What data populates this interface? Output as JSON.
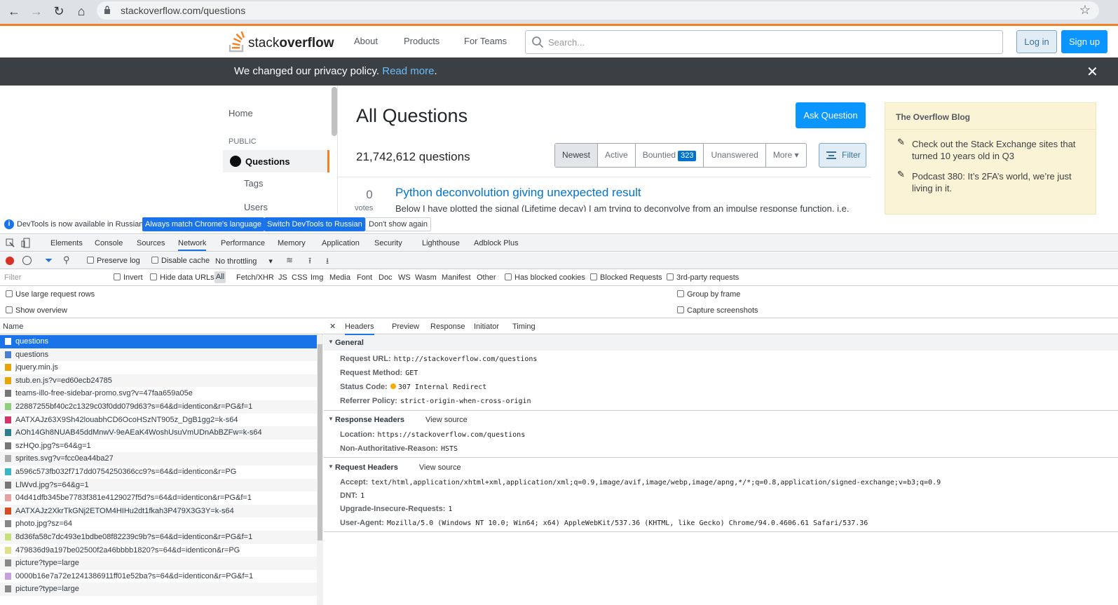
{
  "browser": {
    "url": "stackoverflow.com/questions"
  },
  "so": {
    "logo_prefix": "stack",
    "logo_bold": "overflow",
    "nav": [
      "About",
      "Products",
      "For Teams"
    ],
    "search_placeholder": "Search...",
    "login": "Log in",
    "signup": "Sign up",
    "privacy_text": "We changed our privacy policy.",
    "privacy_link": "Read more",
    "privacy_end": ".",
    "left": {
      "home": "Home",
      "public": "PUBLIC",
      "questions": "Questions",
      "tags": "Tags",
      "users": "Users"
    },
    "title": "All Questions",
    "ask": "Ask Question",
    "count": "21,742,612 questions",
    "tabs": {
      "newest": "Newest",
      "active": "Active",
      "bountied": "Bountied",
      "bounty_count": "323",
      "unanswered": "Unanswered",
      "more": "More"
    },
    "filter": "Filter",
    "question": {
      "votes": "0",
      "votes_label": "votes",
      "title": "Python deconvolution giving unexpected result",
      "excerpt": "Below I have plotted the signal (Lifetime decay) I am trying to deconvolve from an impulse response function, i.e."
    },
    "blog": {
      "heading": "The Overflow Blog",
      "items": [
        "Check out the Stack Exchange sites that turned 10 years old in Q3",
        "Podcast 380: It’s 2FA’s world, we’re just living in it."
      ]
    }
  },
  "devtools": {
    "info": "DevTools is now available in Russian!",
    "btn_match": "Always match Chrome's language",
    "btn_switch": "Switch DevTools to Russian",
    "btn_dont": "Don't show again",
    "tabs": [
      "Elements",
      "Console",
      "Sources",
      "Network",
      "Performance",
      "Memory",
      "Application",
      "Security",
      "Lighthouse",
      "Adblock Plus"
    ],
    "toolbar": {
      "preserve": "Preserve log",
      "disable_cache": "Disable cache",
      "throttling": "No throttling"
    },
    "filter": {
      "placeholder": "Filter",
      "invert": "Invert",
      "hide_data": "Hide data URLs",
      "all": "All",
      "types": [
        "Fetch/XHR",
        "JS",
        "CSS",
        "Img",
        "Media",
        "Font",
        "Doc",
        "WS",
        "Wasm",
        "Manifest",
        "Other"
      ],
      "blocked_cookies": "Has blocked cookies",
      "blocked_requests": "Blocked Requests",
      "third_party": "3rd-party requests"
    },
    "settings": {
      "large_rows": "Use large request rows",
      "overview": "Show overview",
      "group": "Group by frame",
      "screenshots": "Capture screenshots"
    },
    "list_header": "Name",
    "requests": [
      "questions",
      "questions",
      "jquery.min.js",
      "stub.en.js?v=ed60ecb24785",
      "teams-illo-free-sidebar-promo.svg?v=47faa659a05e",
      "22887255bf40c2c1329c03f0dd079d63?s=64&d=identicon&r=PG&f=1",
      "AATXAJz63X9Sh42louabhCD6OcoHSzNT905z_DgB1gg2=k-s64",
      "AOh14Gh8NUAB45ddMnwV-9eAEaK4WoshUsuVmUDnAbBZFw=k-s64",
      "szHQo.jpg?s=64&g=1",
      "sprites.svg?v=fcc0ea44ba27",
      "a596c573fb032f717dd0754250366cc9?s=64&d=identicon&r=PG",
      "LlWvd.jpg?s=64&g=1",
      "04d41dfb345be7783f381e4129027f5d?s=64&d=identicon&r=PG&f=1",
      "AATXAJz2XkrTkGNj2ETOM4HIHu2dt1fkah3P479X3G3Y=k-s64",
      "photo.jpg?sz=64",
      "8d36fa58c7dc493e1bdbe08f82239c9b?s=64&d=identicon&r=PG&f=1",
      "479836d9a197be02500f2a46bbbb1820?s=64&d=identicon&r=PG",
      "picture?type=large",
      "0000b16e7a72e1241386911ff01e52ba?s=64&d=identicon&r=PG&f=1",
      "picture?type=large"
    ],
    "detail_tabs": [
      "Headers",
      "Preview",
      "Response",
      "Initiator",
      "Timing"
    ],
    "general": {
      "title": "General",
      "rows": [
        [
          "Request URL:",
          "http://stackoverflow.com/questions"
        ],
        [
          "Request Method:",
          "GET"
        ],
        [
          "Status Code:",
          "307 Internal Redirect"
        ],
        [
          "Referrer Policy:",
          "strict-origin-when-cross-origin"
        ]
      ]
    },
    "response": {
      "title": "Response Headers",
      "view": "View source",
      "rows": [
        [
          "Location:",
          "https://stackoverflow.com/questions"
        ],
        [
          "Non-Authoritative-Reason:",
          "HSTS"
        ]
      ]
    },
    "request": {
      "title": "Request Headers",
      "view": "View source",
      "rows": [
        [
          "Accept:",
          "text/html,application/xhtml+xml,application/xml;q=0.9,image/avif,image/webp,image/apng,*/*;q=0.8,application/signed-exchange;v=b3;q=0.9"
        ],
        [
          "DNT:",
          "1"
        ],
        [
          "Upgrade-Insecure-Requests:",
          "1"
        ],
        [
          "User-Agent:",
          "Mozilla/5.0 (Windows NT 10.0; Win64; x64) AppleWebKit/537.36 (KHTML, like Gecko) Chrome/94.0.4606.61 Safari/537.36"
        ]
      ]
    }
  }
}
